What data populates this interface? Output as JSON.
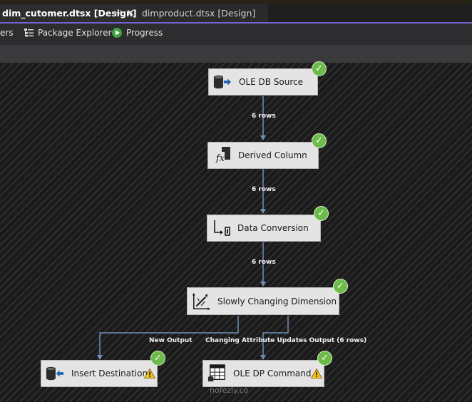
{
  "tabs": [
    {
      "label": "dim_cutomer.dtsx [Design]",
      "active": true,
      "pin": "⊣",
      "close": "✕"
    },
    {
      "label": "dimproduct.dtsx [Design]",
      "active": false
    }
  ],
  "toolbar": {
    "truncated_label": "ers",
    "package_explorer_label": "Package Explorer",
    "progress_label": "Progress"
  },
  "components": {
    "ole_db_source": {
      "label": "OLE DB Source",
      "status": "success"
    },
    "derived_column": {
      "label": "Derived Column",
      "status": "success"
    },
    "data_conversion": {
      "label": "Data Conversion",
      "status": "success"
    },
    "scd": {
      "label": "Slowly Changing Dimension",
      "status": "success"
    },
    "insert_destination": {
      "label": "Insert Destination",
      "status": "success",
      "warning": true
    },
    "ole_db_command": {
      "label": "OLE DP Command",
      "status": "success",
      "warning": true
    }
  },
  "paths": {
    "source_to_derived": "6 rows",
    "derived_to_conversion": "6 rows",
    "conversion_to_scd": "6 rows",
    "scd_new_output": "New Output",
    "scd_changing_output": "Changing Attribute Updates Output (6 rows)"
  },
  "icons": {
    "check": "✓",
    "fx": "fx"
  },
  "watermark": "nofezly.co",
  "colors": {
    "path_line": "#6f8fb5",
    "success_green": "#6dbb4a",
    "warning_yellow": "#f2c21b",
    "tab_accent": "#7a5fd0"
  }
}
